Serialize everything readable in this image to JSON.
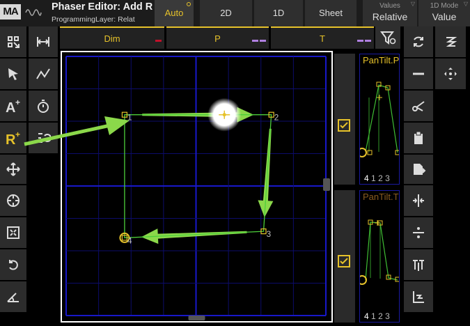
{
  "titlebar": {
    "logo": "MA",
    "title": "Phaser Editor: Add R",
    "subtitle": "ProgrammingLayer: Relat"
  },
  "modes": {
    "auto": "Auto",
    "two_d": "2D",
    "one_d": "1D",
    "sheet": "Sheet"
  },
  "dropdowns": {
    "values": {
      "label": "Values",
      "value": "Relative"
    },
    "mode_1d": {
      "label": "1D Mode",
      "value": "Value"
    }
  },
  "attribute_tabs": [
    "Dim",
    "P",
    "T"
  ],
  "colors": {
    "accent": "#e6c22a",
    "path": "#4ccf3a",
    "arrow": "#8bd84a",
    "grid_major": "#1818c8",
    "grid_minor": "#0c0c6a",
    "tab_mark_red": "#c0102a",
    "tab_mark_purple": "#b080e0"
  },
  "left_tools": [
    "grid-move-icon",
    "range-width-icon",
    "cursor-icon",
    "curve-icon",
    "add-text-icon",
    "stopwatch-icon",
    "add-relative-icon",
    "rotate-steps-icon",
    "move-icon",
    "target-icon",
    "fit-icon",
    "rotate-icon",
    "angle-icon"
  ],
  "right_tools": [
    "refresh-icon",
    "spiral-icon",
    "minus-icon",
    "center-move-icon",
    "cut-icon",
    "paste-icon",
    "paste-insert-icon",
    "split-vertical-icon",
    "divide-icon",
    "split-horizontal-icon",
    "align-bottom-icon"
  ],
  "steps": [
    {
      "label": "1",
      "pan": -0.55,
      "tilt": 0.55
    },
    {
      "label": "2",
      "pan": 0.58,
      "tilt": 0.55
    },
    {
      "label": "3",
      "pan": 0.52,
      "tilt": -0.35
    },
    {
      "label": "4",
      "pan": -0.55,
      "tilt": -0.4
    }
  ],
  "mini_graphs": [
    {
      "title": "PanTilt.P",
      "step_numbers": [
        "4",
        "1",
        "2",
        "3"
      ]
    },
    {
      "title": "PanTilt.T",
      "step_numbers": [
        "4",
        "1",
        "2",
        "3"
      ]
    }
  ]
}
